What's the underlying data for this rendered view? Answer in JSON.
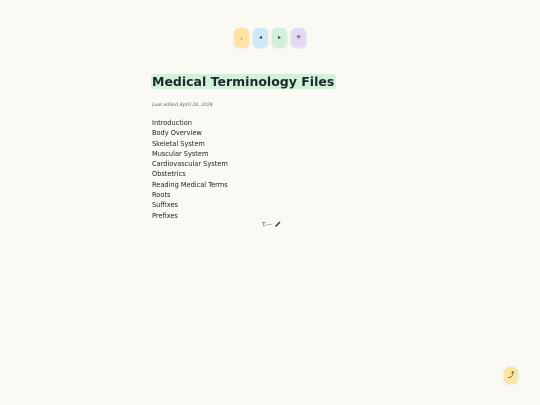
{
  "toolbar": {
    "buttons": [
      {
        "icon": "comma-icon",
        "glyph": ",",
        "color": "#fde4a3"
      },
      {
        "icon": "prev-icon",
        "glyph": "◂",
        "color": "#cde8f6"
      },
      {
        "icon": "next-icon",
        "glyph": "▸",
        "color": "#d3f0dd"
      },
      {
        "icon": "sparkle-icon",
        "glyph": "✳",
        "color": "#e3d8f5"
      }
    ]
  },
  "document": {
    "title": "Medical Terminology Files",
    "title_highlight": "#d3f0dd",
    "last_edited": "Last edited April 26, 2024",
    "items": [
      "Introduction",
      "Body Overview",
      "Skeletal System",
      "Muscular System",
      "Cardiovascular System",
      "Obstetrics",
      "Reading Medical Terms",
      "Roots",
      "Suffixes",
      "Prefixes"
    ],
    "signoff": "T.—",
    "signoff_icon": "pen-icon"
  },
  "scroll_top": {
    "icon": "arrow-up-icon",
    "glyph": "⤴",
    "color": "#fde4a3"
  }
}
